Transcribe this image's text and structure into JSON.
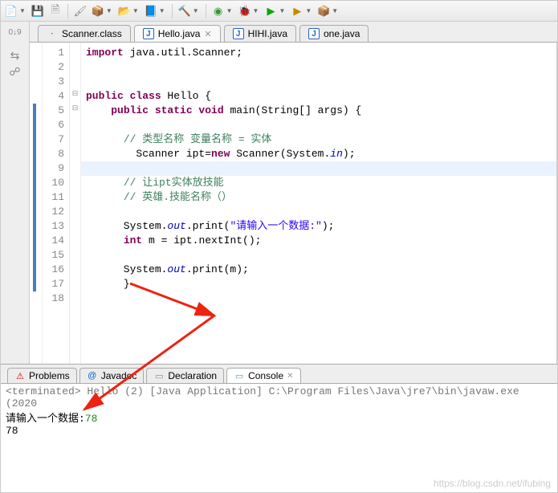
{
  "toolbar_icons": [
    "folder",
    "disk",
    "disk-all",
    "brush",
    "ext",
    "search",
    "box",
    "hammer",
    "green-sq",
    "run-ext",
    "run",
    "debug",
    "stop",
    "pkg"
  ],
  "tabs": [
    {
      "icon": "classfile",
      "label": "Scanner.class",
      "active": false
    },
    {
      "icon": "jfile",
      "label": "Hello.java",
      "active": true
    },
    {
      "icon": "jfile",
      "label": "HIHI.java",
      "active": false
    },
    {
      "icon": "jfile",
      "label": "one.java",
      "active": false
    }
  ],
  "code": {
    "lines": [
      {
        "n": 1,
        "frag": [
          {
            "t": "import ",
            "c": "kw"
          },
          {
            "t": "java.util.Scanner;",
            "c": ""
          }
        ]
      },
      {
        "n": 2,
        "frag": [
          {
            "t": "",
            "c": ""
          }
        ]
      },
      {
        "n": 3,
        "frag": [
          {
            "t": "",
            "c": ""
          }
        ]
      },
      {
        "n": 4,
        "frag": [
          {
            "t": "public class ",
            "c": "kw"
          },
          {
            "t": "Hello {",
            "c": ""
          }
        ],
        "fold": "⊟"
      },
      {
        "n": 5,
        "frag": [
          {
            "t": "    ",
            "c": ""
          },
          {
            "t": "public static void ",
            "c": "kw"
          },
          {
            "t": "main(String[] args) {",
            "c": ""
          }
        ],
        "fold": "⊟",
        "bar": true
      },
      {
        "n": 6,
        "frag": [
          {
            "t": "",
            "c": ""
          }
        ],
        "bar": true
      },
      {
        "n": 7,
        "frag": [
          {
            "t": "      ",
            "c": ""
          },
          {
            "t": "// 类型名称 变量名称 = 实体",
            "c": "cm"
          }
        ],
        "bar": true
      },
      {
        "n": 8,
        "frag": [
          {
            "t": "        Scanner ipt=",
            "c": ""
          },
          {
            "t": "new ",
            "c": "kw"
          },
          {
            "t": "Scanner(System.",
            "c": ""
          },
          {
            "t": "in",
            "c": "fld"
          },
          {
            "t": ");",
            "c": ""
          }
        ],
        "bar": true
      },
      {
        "n": 9,
        "frag": [
          {
            "t": "",
            "c": ""
          }
        ],
        "bar": true,
        "hl": true
      },
      {
        "n": 10,
        "frag": [
          {
            "t": "      ",
            "c": ""
          },
          {
            "t": "// 让ipt实体放技能",
            "c": "cm"
          }
        ],
        "bar": true
      },
      {
        "n": 11,
        "frag": [
          {
            "t": "      ",
            "c": ""
          },
          {
            "t": "// 英雄.技能名称（）",
            "c": "cm"
          }
        ],
        "bar": true
      },
      {
        "n": 12,
        "frag": [
          {
            "t": "",
            "c": ""
          }
        ],
        "bar": true
      },
      {
        "n": 13,
        "frag": [
          {
            "t": "      System.",
            "c": ""
          },
          {
            "t": "out",
            "c": "fld"
          },
          {
            "t": ".print(",
            "c": ""
          },
          {
            "t": "\"请输入一个数据:\"",
            "c": "str"
          },
          {
            "t": ");",
            "c": ""
          }
        ],
        "bar": true
      },
      {
        "n": 14,
        "frag": [
          {
            "t": "      ",
            "c": ""
          },
          {
            "t": "int ",
            "c": "kw"
          },
          {
            "t": "m = ipt.nextInt();",
            "c": ""
          }
        ],
        "bar": true
      },
      {
        "n": 15,
        "frag": [
          {
            "t": "",
            "c": ""
          }
        ],
        "bar": true
      },
      {
        "n": 16,
        "frag": [
          {
            "t": "      System.",
            "c": ""
          },
          {
            "t": "out",
            "c": "fld"
          },
          {
            "t": ".print(m);",
            "c": ""
          }
        ],
        "bar": true
      },
      {
        "n": 17,
        "frag": [
          {
            "t": "      }",
            "c": ""
          }
        ],
        "bar": true
      },
      {
        "n": 18,
        "frag": [
          {
            "t": "",
            "c": ""
          }
        ]
      }
    ]
  },
  "bottom_tabs": [
    {
      "icon": "⚠",
      "color": "#c00",
      "label": "Problems",
      "active": false
    },
    {
      "icon": "@",
      "color": "#06c",
      "label": "Javadoc",
      "active": false
    },
    {
      "icon": "▭",
      "color": "#888",
      "label": "Declaration",
      "active": false
    },
    {
      "icon": "▭",
      "color": "#59b",
      "label": "Console",
      "active": true,
      "close": true
    }
  ],
  "console": {
    "status": "<terminated> Hello (2) [Java Application] C:\\Program Files\\Java\\jre7\\bin\\javaw.exe (2020",
    "prompt": "请输入一个数据:",
    "input": "78",
    "output": "78"
  },
  "watermark": "https://blog.csdn.net/ifubing"
}
